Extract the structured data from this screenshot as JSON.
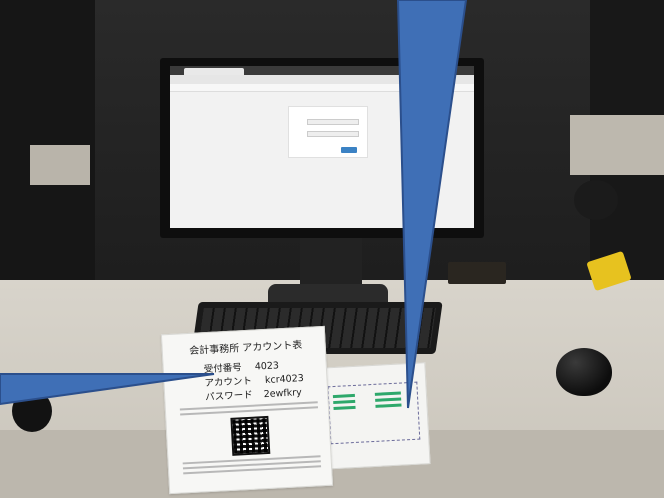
{
  "photo": {
    "document": {
      "title": "会計事務所 アカウント表",
      "rows": [
        {
          "label": "受付番号",
          "value": "4023"
        },
        {
          "label": "アカウント",
          "value": "kcr4023"
        },
        {
          "label": "パスワード",
          "value": "2ewfkry"
        }
      ]
    }
  },
  "colors": {
    "pointer_blue": "#3f6fb6",
    "pointer_edge": "#2b4f8c"
  }
}
